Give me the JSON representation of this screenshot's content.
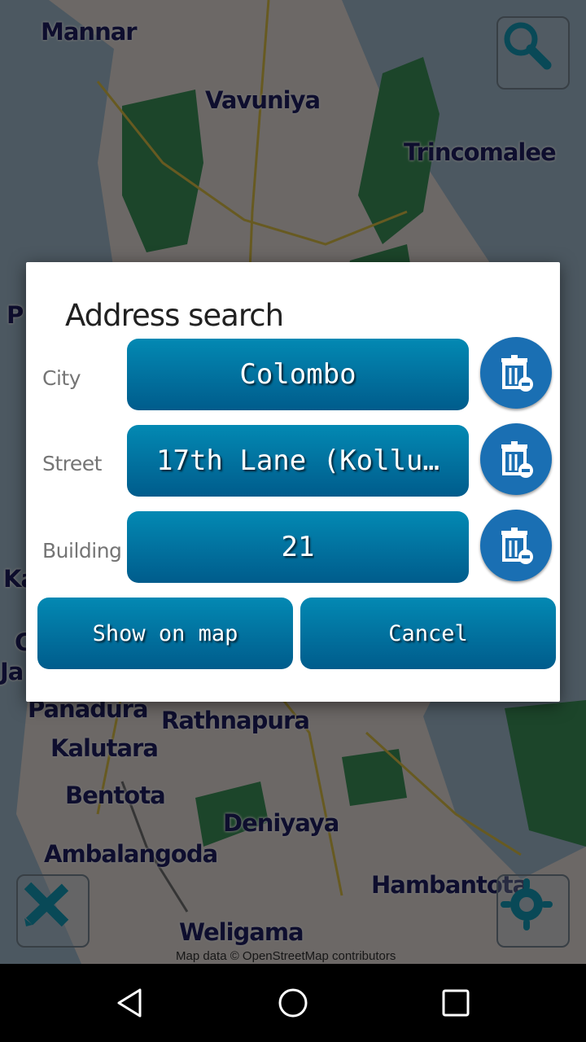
{
  "map": {
    "city_labels": [
      "Mannar",
      "Vavuniya",
      "Trincomalee",
      "Panadura",
      "Rathnapura",
      "Kalutara",
      "Bentota",
      "Deniyaya",
      "Ambalangoda",
      "Hambantota",
      "Weligama",
      "P",
      "Ka",
      "C",
      "Ja"
    ],
    "attribution": "Map data © OpenStreetMap contributors",
    "buttons": {
      "search": "search-icon",
      "measure": "ruler-pencil-icon",
      "locate": "locate-icon"
    }
  },
  "dialog": {
    "title": "Address search",
    "rows": [
      {
        "label": "City",
        "value": "Colombo"
      },
      {
        "label": "Street",
        "value": "17th Lane (Kollu…"
      },
      {
        "label": "Building",
        "value": "21"
      }
    ],
    "show_on_map": "Show on map",
    "cancel": "Cancel"
  },
  "colors": {
    "button_top": "#0389b3",
    "button_bottom": "#005c8c",
    "trash_bg": "#1a6fb3",
    "city_label": "#1f1f66"
  },
  "navbar": {
    "back": "back-icon",
    "home": "home-icon",
    "recents": "recents-icon"
  }
}
